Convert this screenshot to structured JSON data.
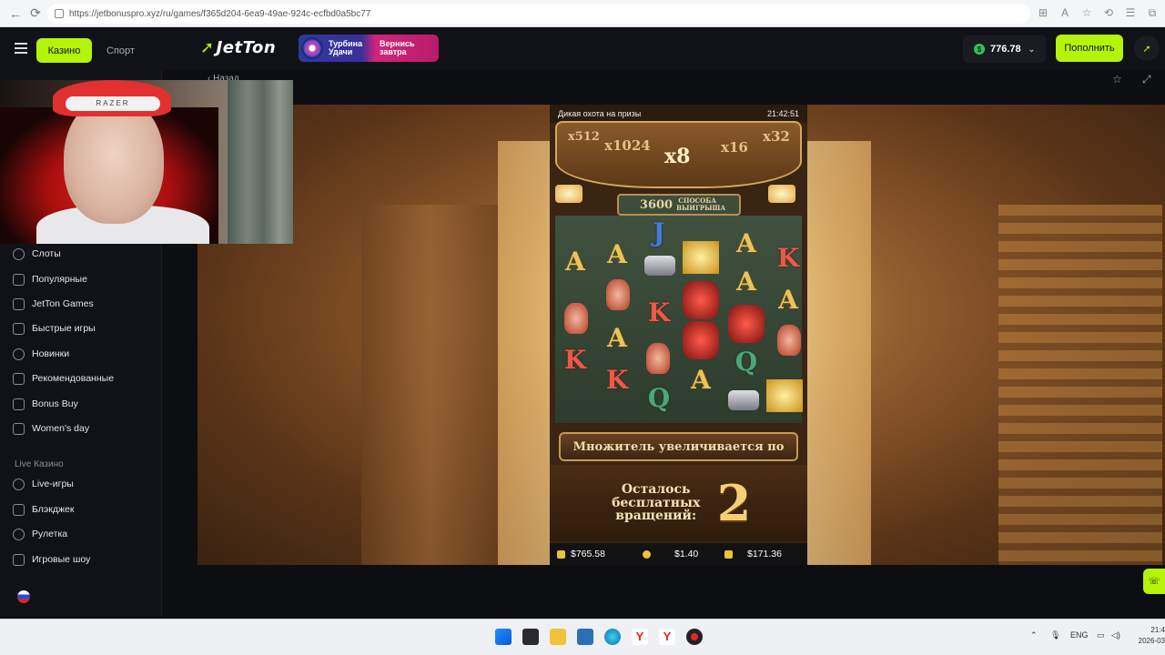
{
  "browser": {
    "url": "https://jetbonuspro.xyz/ru/games/f365d204-6ea9-49ae-924c-ecfbd0a5bc77"
  },
  "header": {
    "tab_casino": "Казино",
    "tab_sport": "Спорт",
    "logo": "JetTon",
    "promo_left": "Турбина Удачи",
    "promo_right": "Вернись завтра",
    "balance": "776.78",
    "deposit": "Пополнить"
  },
  "page": {
    "back": "Назад"
  },
  "sidebar": {
    "items": [
      {
        "label": "Слоты"
      },
      {
        "label": "Популярные"
      },
      {
        "label": "JetTon Games"
      },
      {
        "label": "Быстрые игры"
      },
      {
        "label": "Новинки"
      },
      {
        "label": "Рекомендованные"
      },
      {
        "label": "Bonus Buy"
      },
      {
        "label": "Women's day"
      }
    ],
    "live_section": "Live Казино",
    "live_items": [
      {
        "label": "Live-игры"
      },
      {
        "label": "Блэкджек"
      },
      {
        "label": "Рулетка"
      },
      {
        "label": "Игровые шоу"
      }
    ]
  },
  "webcam": {
    "band_text": "RAZER"
  },
  "game": {
    "title": "Дикая охота на призы",
    "time": "21:42:51",
    "multipliers": [
      "x512",
      "x1024",
      "x8",
      "x16",
      "x32"
    ],
    "ways_number": "3600",
    "ways_text": "СПОСОБА ВЫИГРЫША",
    "banner": "Множитель увеличивается по",
    "free_spins_text": "Осталось бесплатных вращений:",
    "free_spins_count": "2",
    "balance": "$765.58",
    "bet": "$1.40",
    "win": "$171.36"
  },
  "taskbar": {
    "lang": "ENG",
    "time": "21:4",
    "date": "2026-03"
  },
  "colors": {
    "accent": "#b4f30a",
    "header_bg": "#111217"
  }
}
